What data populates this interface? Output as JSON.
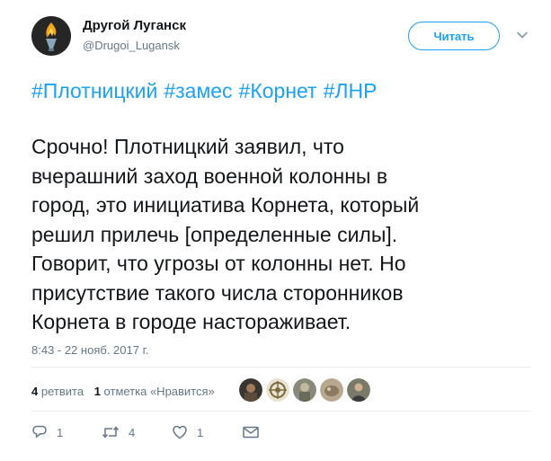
{
  "header": {
    "display_name": "Другой Луганск",
    "handle": "@Drugoi_Lugansk",
    "follow_label": "Читать"
  },
  "hashtags": [
    "#Плотницкий",
    "#замес",
    "#Корнет",
    "#ЛНР"
  ],
  "text_lines": [
    "Срочно! Плотницкий заявил, что",
    "вчерашний заход военной колонны в",
    "город, это инициатива Корнета, который",
    "решил прилечь [определенные силы].",
    "Говорит, что угрозы от колонны нет.  Но",
    "присутствие такого числа сторонников",
    "Корнета в городе настораживает."
  ],
  "timestamp": "8:43 - 22 нояб. 2017 г.",
  "stats": {
    "retweets_count": "4",
    "retweets_label": "ретвита",
    "likes_count": "1",
    "likes_label": "отметка «Нравится»"
  },
  "actions": {
    "reply_count": "1",
    "retweet_count": "4",
    "like_count": "1"
  },
  "icons": {
    "reply": "reply-icon",
    "retweet": "retweet-icon",
    "like": "heart-icon",
    "message": "envelope-icon",
    "more": "chevron-down-icon"
  },
  "colors": {
    "accent": "#1da1f2",
    "muted": "#657786",
    "text": "#14171a",
    "divider": "#e6ecf0"
  }
}
